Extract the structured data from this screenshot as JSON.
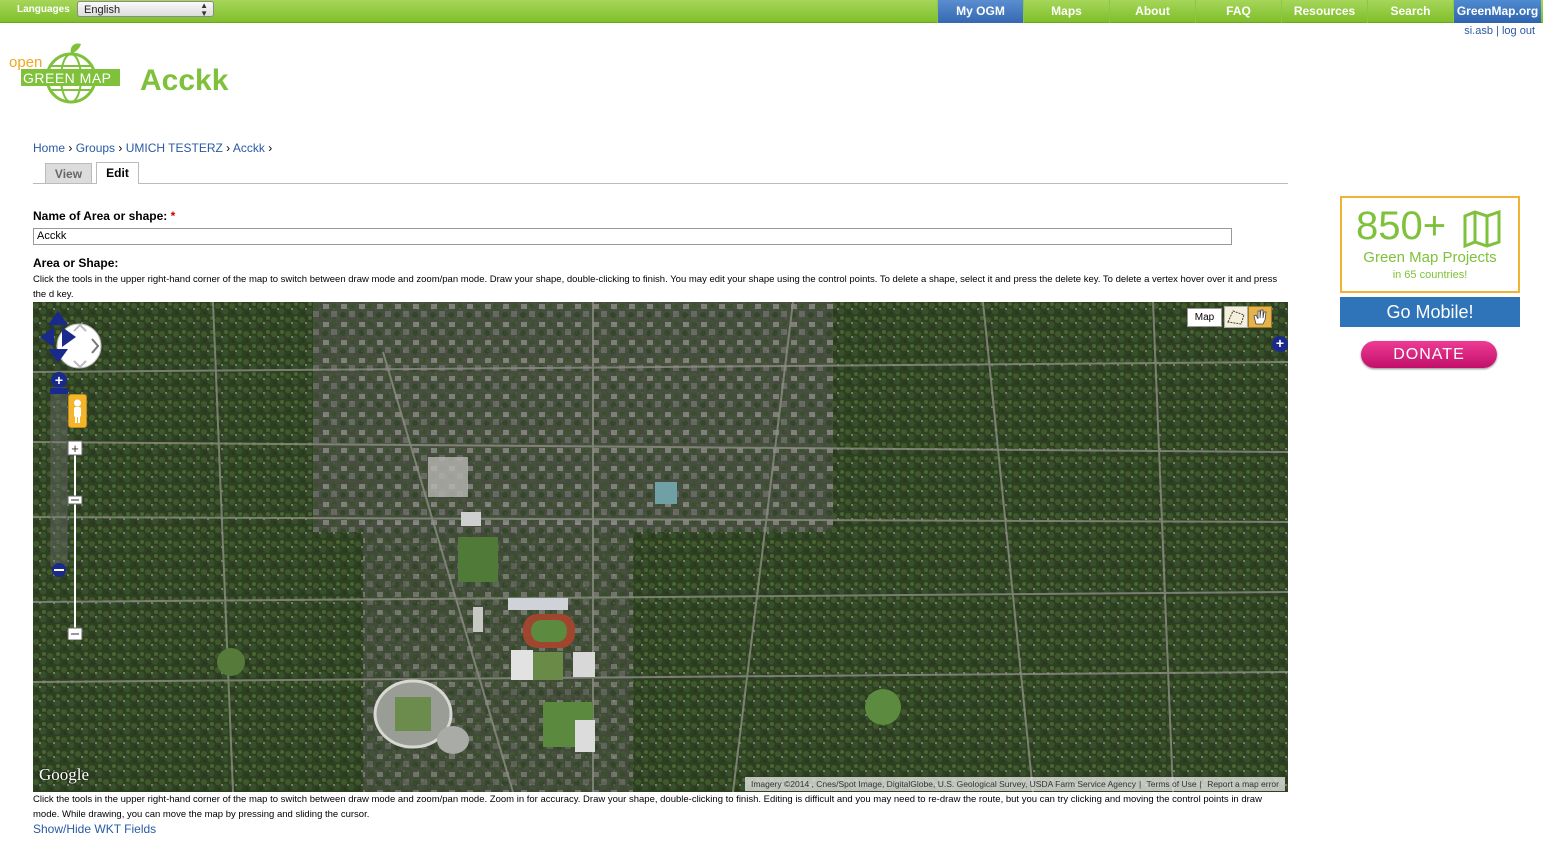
{
  "topbar": {
    "languages_label": "Languages",
    "language_value": "English",
    "nav": [
      "My OGM",
      "Maps",
      "About",
      "FAQ",
      "Resources",
      "Search",
      "GreenMap.org"
    ]
  },
  "user": {
    "username": "si.asb",
    "logout": "log out"
  },
  "logo": {
    "open": "open",
    "green_map": "GREEN MAP"
  },
  "page_title": "Acckk",
  "breadcrumb": [
    "Home",
    "Groups",
    "UMICH TESTERZ",
    "Acckk"
  ],
  "tabs": {
    "view": "View",
    "edit": "Edit"
  },
  "form": {
    "name_label": "Name of Area or shape:",
    "required_mark": "*",
    "name_value": "Acckk",
    "shape_label": "Area or Shape:",
    "shape_help": "Click the tools in the upper right-hand corner of the map to switch between draw mode and zoom/pan mode. Draw your shape, double-clicking to finish. You may edit your shape using the control points. To delete a shape, select it and press the delete key. To delete a vertex hover over it and press the d key.",
    "map_help": "Click the tools in the upper right-hand corner of the map to switch between draw mode and zoom/pan mode. Zoom in for accuracy. Draw your shape, double-clicking to finish. Editing is difficult and you may need to re-draw the route, but you can try clicking and moving the control points in draw mode. While drawing, you can move the map by pressing and sliding the cursor.",
    "show_hide": "Show/Hide WKT Fields"
  },
  "map": {
    "map_type": "Map",
    "google": "Google",
    "attribution": "Imagery ©2014 , Cnes/Spot Image, DigitalGlobe, U.S. Geological Survey, USDA Farm Service Agency",
    "terms": "Terms of Use",
    "report": "Report a map error",
    "icons": [
      "pan-arrows-icon",
      "zoom-in-icon",
      "zoom-out-icon",
      "pegman-icon",
      "draw-tool-icon",
      "pan-tool-icon"
    ]
  },
  "sidebar": {
    "promo_big": "850+",
    "promo_line2": "Green Map Projects",
    "promo_line3": "in 65 countries!",
    "go_mobile": "Go Mobile!",
    "donate": "DONATE"
  },
  "colors": {
    "green": "#7fc13a",
    "link": "#2a5aa3",
    "orange": "#f2b232",
    "blue": "#2f73b8",
    "pink": "#e0267f"
  }
}
